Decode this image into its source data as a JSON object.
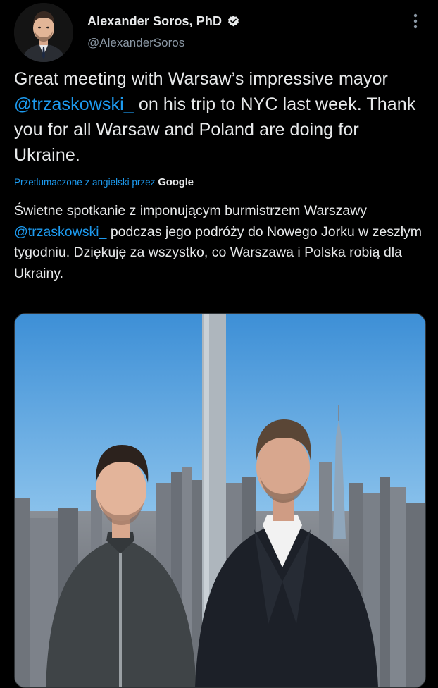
{
  "author": {
    "display_name": "Alexander Soros, PhD",
    "handle": "@AlexanderSoros",
    "avatar_icon": "profile-photo",
    "verified_icon": "verified-badge-icon"
  },
  "tweet": {
    "part1": "Great meeting with Warsaw’s impressive mayor ",
    "mention": "@trzaskowski_",
    "part2": " on his trip to NYC last week. Thank you for all Warsaw and Poland are doing for Ukraine."
  },
  "translation": {
    "label": "Przetlumaczone z angielski przez",
    "provider": "Google",
    "part1": "Świetne spotkanie z imponującym burmistrzem Warszawy ",
    "mention": "@trzaskowski_",
    "part2": " podczas jego podróży do Nowego Jorku w zeszłym tygodniu. Dziękuję za wszystko, co Warszawa i Polska robią dla Ukrainy."
  },
  "colors": {
    "background": "#000000",
    "text": "#e7e9ea",
    "secondary_text": "#8b98a5",
    "accent": "#1d9bf0"
  },
  "icons": {
    "more": "more-vertical-icon",
    "verified": "verified-badge-icon"
  }
}
